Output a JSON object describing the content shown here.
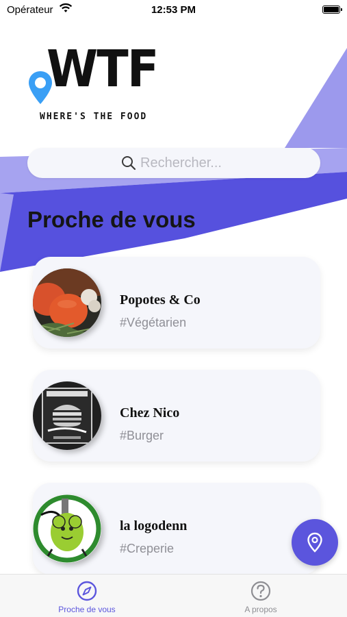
{
  "status_bar": {
    "carrier": "Opérateur",
    "time": "12:53 PM",
    "battery_level": 1.0
  },
  "logo": {
    "wordmark": "WTF",
    "tagline": "WHERE'S THE FOOD"
  },
  "search": {
    "placeholder": "Rechercher..."
  },
  "section_title": "Proche de vous",
  "restaurants": [
    {
      "name": "Popotes & Co",
      "tag": "#Végétarien",
      "image": "vegetables-photo"
    },
    {
      "name": "Chez Nico",
      "tag": "#Burger",
      "image": "burger-foodtruck-logo"
    },
    {
      "name": "la logodenn",
      "tag": "#Creperie",
      "image": "mouse-mascot-logo"
    }
  ],
  "tabs": [
    {
      "label": "Proche de vous",
      "icon": "compass-icon",
      "active": true
    },
    {
      "label": "A propos",
      "icon": "question-circle-icon",
      "active": false
    }
  ],
  "colors": {
    "accent": "#5b55dd",
    "background_shape_light": "#a5a2ef",
    "background_shape_dark": "#5651de"
  }
}
